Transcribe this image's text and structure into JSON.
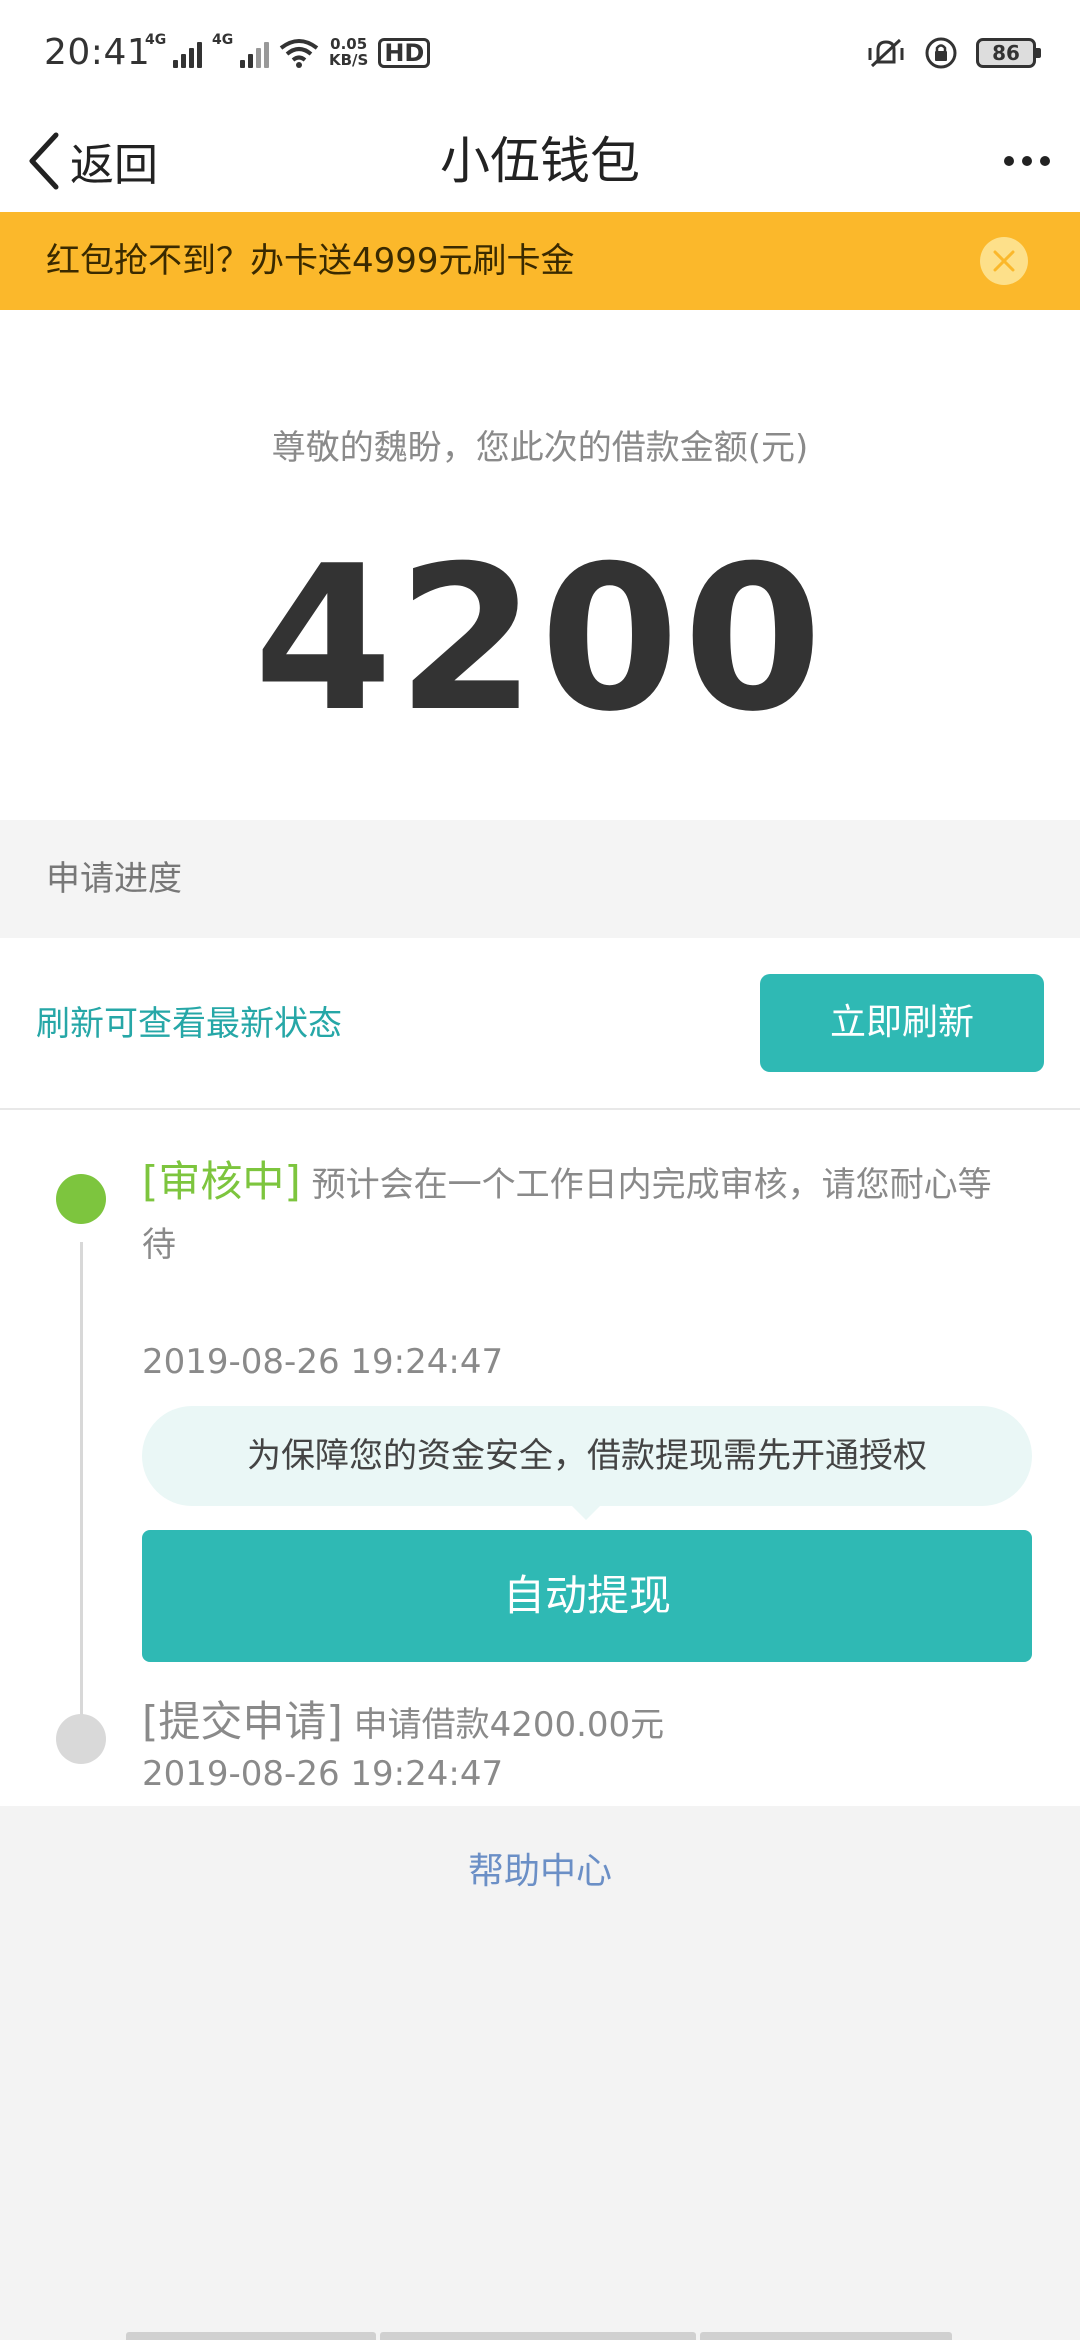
{
  "status_bar": {
    "time": "20:41",
    "network_tag_1": "4G",
    "network_tag_2": "4G",
    "speed_value": "0.05",
    "speed_unit": "KB/S",
    "hd_label": "HD",
    "battery_level": "86"
  },
  "nav": {
    "back_label": "返回",
    "title": "小伍钱包"
  },
  "banner": {
    "text": "红包抢不到？办卡送4999元刷卡金"
  },
  "amount": {
    "label": "尊敬的魏盼，您此次的借款金额(元)",
    "value": "4200"
  },
  "progress": {
    "header": "申请进度",
    "refresh_hint": "刷新可查看最新状态",
    "refresh_button": "立即刷新"
  },
  "timeline": {
    "step1": {
      "status": "[审核中]",
      "description": " 预计会在一个工作日内完成审核，请您耐心等待",
      "time": "2019-08-26 19:24:47"
    },
    "tip": "为保障您的资金安全，借款提现需先开通授权",
    "auto_button": "自动提现",
    "step2": {
      "status": "[提交申请]",
      "description": " 申请借款4200.00元",
      "time": "2019-08-26 19:24:47"
    }
  },
  "help": {
    "label": "帮助中心"
  },
  "colors": {
    "accent": "#2fb9b4",
    "banner": "#fbb82b",
    "active_step": "#7dc53e",
    "link": "#6b8fc6"
  }
}
